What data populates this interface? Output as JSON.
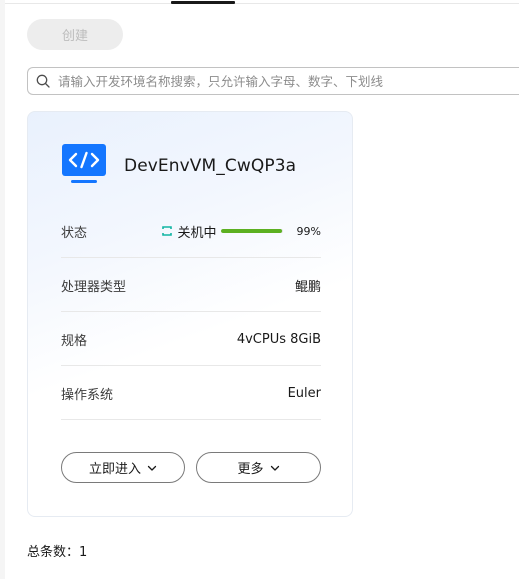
{
  "toolbar": {
    "create_label": "创建"
  },
  "search": {
    "placeholder": "请输入开发环境名称搜索，只允许输入字母、数字、下划线",
    "value": ""
  },
  "card": {
    "name": "DevEnvVM_CwQP3a",
    "status": {
      "label": "状态",
      "text": "关机中",
      "progress": 99,
      "progress_text": "99%",
      "color": "#5cb021"
    },
    "rows": [
      {
        "label": "处理器类型",
        "value": "鲲鹏"
      },
      {
        "label": "规格",
        "value": "4vCPUs 8GiB"
      },
      {
        "label": "操作系统",
        "value": "Euler"
      }
    ],
    "actions": {
      "enter_label": "立即进入",
      "more_label": "更多"
    }
  },
  "footer": {
    "total": "总条数：1"
  },
  "colors": {
    "accent": "#1476ff",
    "progress": "#5cb021"
  }
}
